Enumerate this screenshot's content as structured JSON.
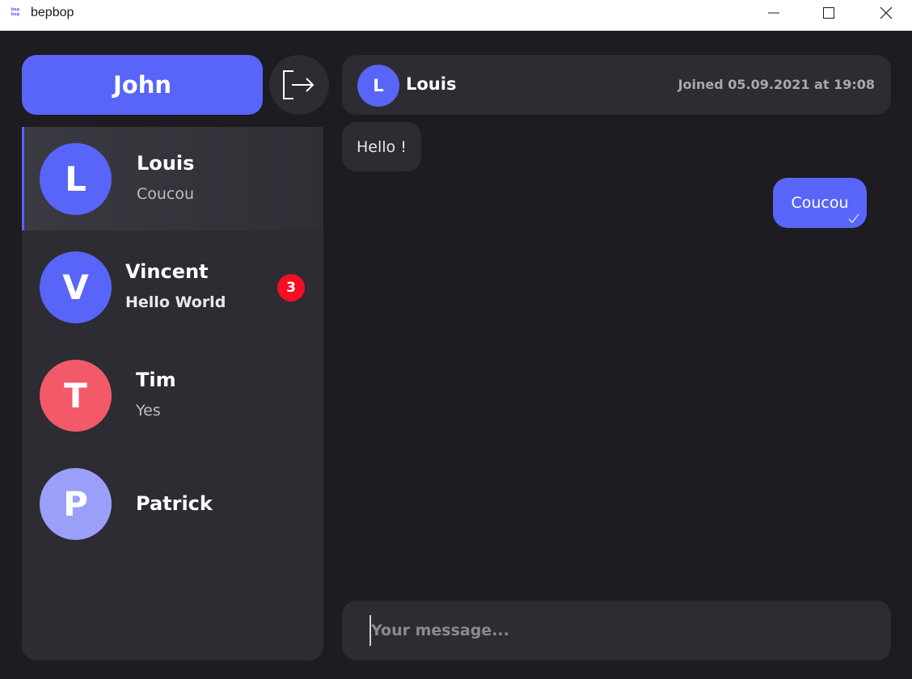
{
  "window": {
    "title": "bepbop",
    "icon_text": "bep bop"
  },
  "profile": {
    "name": "John"
  },
  "conversations": [
    {
      "initial": "L",
      "name": "Louis",
      "last_message": "Coucou",
      "avatar_color": "#5865f8",
      "active": true
    },
    {
      "initial": "V",
      "name": "Vincent",
      "last_message": "Hello World",
      "avatar_color": "#5865f8",
      "unread_count": "3"
    },
    {
      "initial": "T",
      "name": "Tim",
      "last_message": "Yes",
      "avatar_color": "#f25a6a"
    },
    {
      "initial": "P",
      "name": "Patrick",
      "last_message": "",
      "avatar_color": "#9aa0fa"
    }
  ],
  "chat": {
    "contact_initial": "L",
    "contact_name": "Louis",
    "joined": "Joined 05.09.2021 at 19:08",
    "messages": [
      {
        "direction": "incoming",
        "text": "Hello !"
      },
      {
        "direction": "outgoing",
        "text": "Coucou",
        "status": "sent"
      }
    ]
  },
  "composer": {
    "placeholder": "Your message...",
    "value": ""
  },
  "colors": {
    "accent": "#5865f8",
    "background": "#1c1c21",
    "panel": "#2c2c32",
    "badge": "#f50d25"
  }
}
